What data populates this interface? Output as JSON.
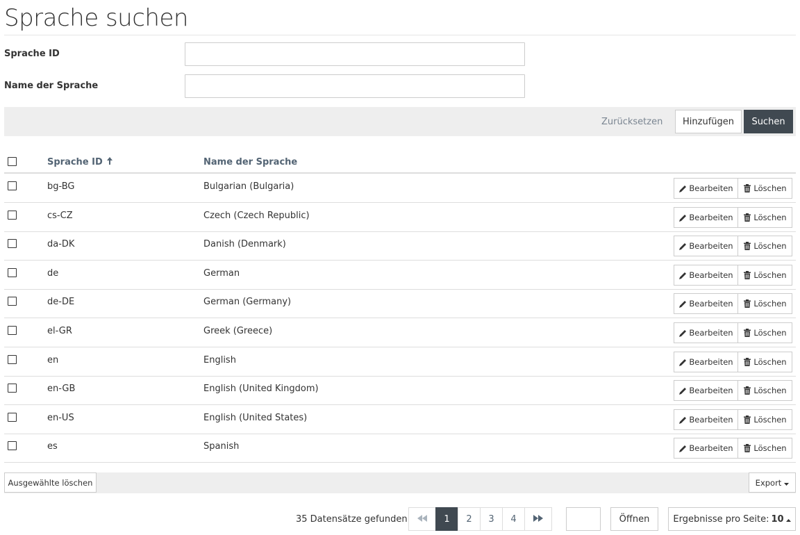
{
  "page": {
    "title": "Sprache suchen"
  },
  "form": {
    "id_label": "Sprache ID",
    "id_value": "",
    "name_label": "Name der Sprache",
    "name_value": ""
  },
  "actions": {
    "reset_label": "Zurücksetzen",
    "add_label": "Hinzufügen",
    "search_label": "Suchen"
  },
  "table": {
    "columns": {
      "id": "Sprache ID",
      "name": "Name der Sprache"
    },
    "sort_icon": "arrow-up-icon",
    "edit_label": "Bearbeiten",
    "delete_label": "Löschen",
    "rows": [
      {
        "id": "bg-BG",
        "name": "Bulgarian (Bulgaria)"
      },
      {
        "id": "cs-CZ",
        "name": "Czech (Czech Republic)"
      },
      {
        "id": "da-DK",
        "name": "Danish (Denmark)"
      },
      {
        "id": "de",
        "name": "German"
      },
      {
        "id": "de-DE",
        "name": "German (Germany)"
      },
      {
        "id": "el-GR",
        "name": "Greek (Greece)"
      },
      {
        "id": "en",
        "name": "English"
      },
      {
        "id": "en-GB",
        "name": "English (United Kingdom)"
      },
      {
        "id": "en-US",
        "name": "English (United States)"
      },
      {
        "id": "es",
        "name": "Spanish"
      }
    ]
  },
  "footer": {
    "delete_selected_label": "Ausgewählte löschen",
    "export_label": "Export"
  },
  "pagination": {
    "records_text": "35 Datensätze gefunden",
    "pages": [
      "1",
      "2",
      "3",
      "4"
    ],
    "current_page": "1",
    "goto_value": "",
    "open_label": "Öffnen",
    "per_page_label": "Ergebnisse pro Seite:",
    "per_page_value": "10"
  },
  "colors": {
    "primary": "#404951",
    "header_text": "#536474",
    "bar_background": "#eeeeee"
  }
}
